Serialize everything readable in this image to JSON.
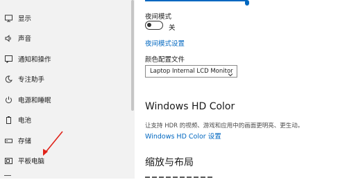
{
  "sidebar": {
    "items": [
      {
        "label": "显示",
        "icon": "monitor-icon"
      },
      {
        "label": "声音",
        "icon": "speaker-icon"
      },
      {
        "label": "通知和操作",
        "icon": "notification-icon"
      },
      {
        "label": "专注助手",
        "icon": "moon-icon"
      },
      {
        "label": "电源和睡眠",
        "icon": "power-icon"
      },
      {
        "label": "电池",
        "icon": "battery-icon"
      },
      {
        "label": "存储",
        "icon": "storage-icon"
      },
      {
        "label": "平板电脑",
        "icon": "tablet-icon"
      }
    ]
  },
  "main": {
    "brightness_level": 0.98,
    "night_mode": {
      "title": "夜间模式",
      "state_label": "关",
      "settings_link": "夜间模式设置"
    },
    "color_profile": {
      "label": "颜色配置文件",
      "selected": "Laptop Internal LCD Monitor"
    },
    "hd_color": {
      "heading": "Windows HD Color",
      "description": "让支持 HDR 的视频、游戏和应用中的画面更明亮、更生动。",
      "settings_link": "Windows HD Color 设置"
    },
    "scale_layout": {
      "heading": "缩放与布局"
    }
  },
  "annotation": {
    "arrow_color": "#e0231a"
  },
  "colors": {
    "accent": "#0067c0",
    "sidebar_bg": "#f2f2f2"
  }
}
